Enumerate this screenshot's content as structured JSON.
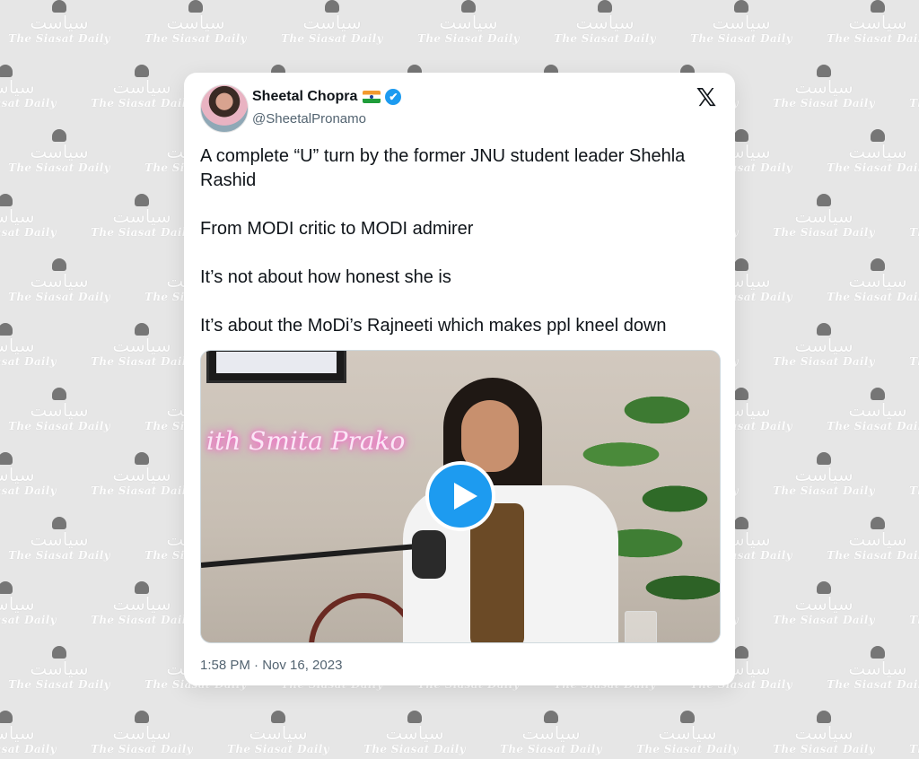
{
  "watermark": {
    "arabic": "سیاست",
    "latin": "The Siasat Daily"
  },
  "tweet": {
    "display_name": "Sheetal Chopra",
    "handle": "@SheetalPronamo",
    "verified_icon": "✔",
    "x_logo": "𝕏",
    "paragraphs": [
      "A complete “U” turn by the former JNU student leader Shehla Rashid",
      "From MODI critic to MODI admirer",
      "It’s not about how honest she is",
      "It’s about the MoDi’s Rajneeti which makes ppl kneel down"
    ],
    "media": {
      "neon_text": "ith Smita Prako"
    },
    "timestamp": "1:58 PM · Nov 16, 2023"
  },
  "colors": {
    "background": "#e6e6e6",
    "verified": "#1d9bf0",
    "play_button": "#1d9bf0",
    "text_primary": "#0f1419",
    "text_secondary": "#536471"
  }
}
